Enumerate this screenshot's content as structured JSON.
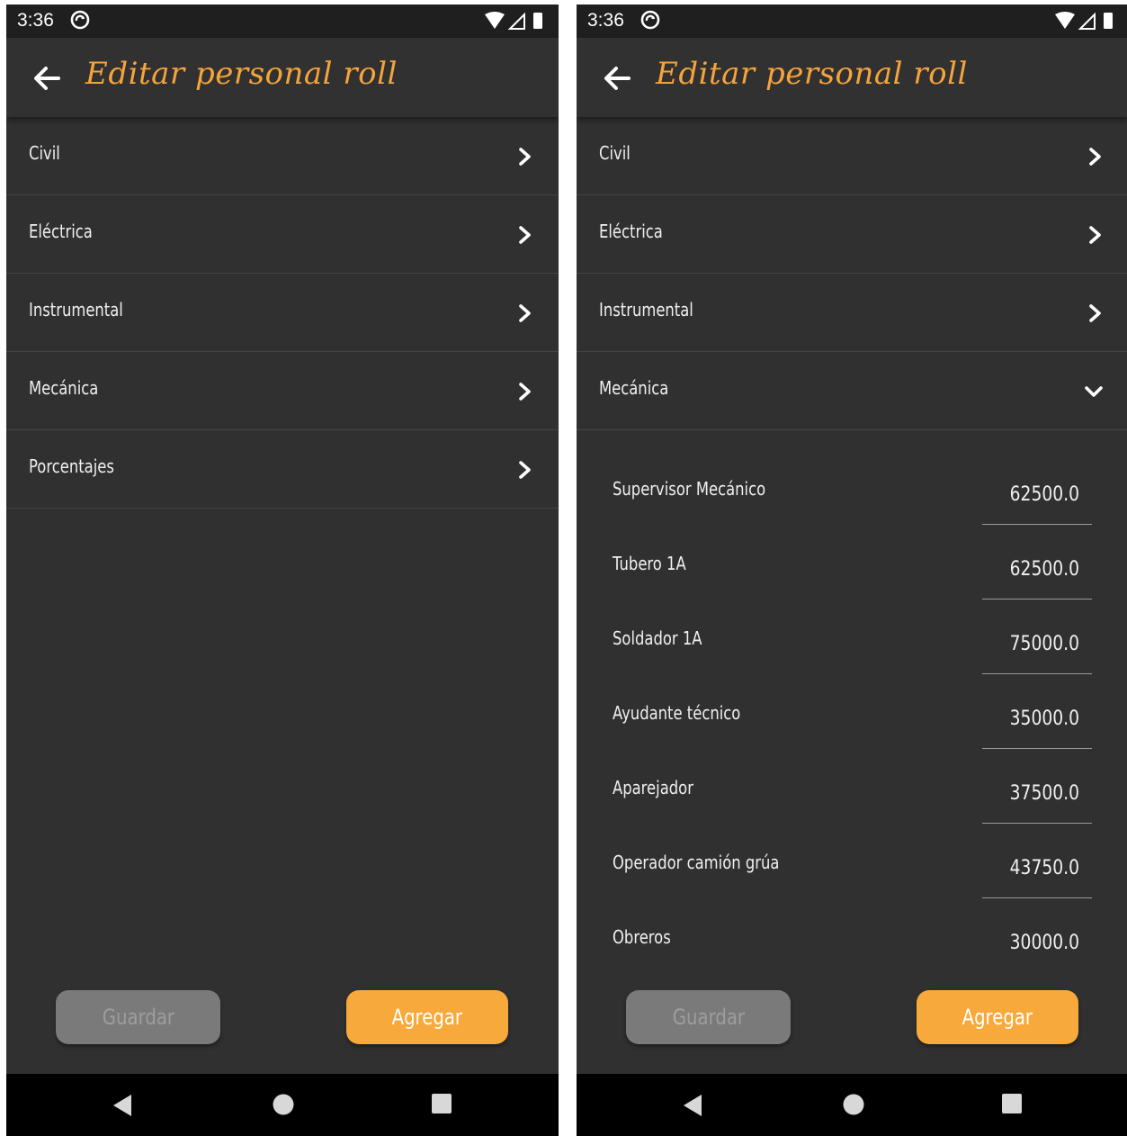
{
  "status_bar": {
    "time": "3:36"
  },
  "app_bar": {
    "title": "Editar personal roll"
  },
  "left": {
    "categories": [
      "Civil",
      "Eléctrica",
      "Instrumental",
      "Mecánica",
      "Porcentajes"
    ]
  },
  "right": {
    "categories": [
      "Civil",
      "Eléctrica",
      "Instrumental",
      "Mecánica"
    ],
    "expanded_category": "Mecánica",
    "items": [
      {
        "name": "Supervisor Mecánico",
        "value": "62500.0"
      },
      {
        "name": "Tubero 1A",
        "value": "62500.0"
      },
      {
        "name": "Soldador 1A",
        "value": "75000.0"
      },
      {
        "name": "Ayudante técnico",
        "value": "35000.0"
      },
      {
        "name": "Aparejador",
        "value": "37500.0"
      },
      {
        "name": "Operador camión grúa",
        "value": "43750.0"
      },
      {
        "name": "Obreros",
        "value": "30000.0"
      }
    ]
  },
  "buttons": {
    "save_label": "Guardar",
    "add_label": "Agregar"
  },
  "colors": {
    "accent": "#F8A93C",
    "background": "#303030",
    "appbar": "#313131",
    "disabled_button": "#7A7A7A"
  }
}
